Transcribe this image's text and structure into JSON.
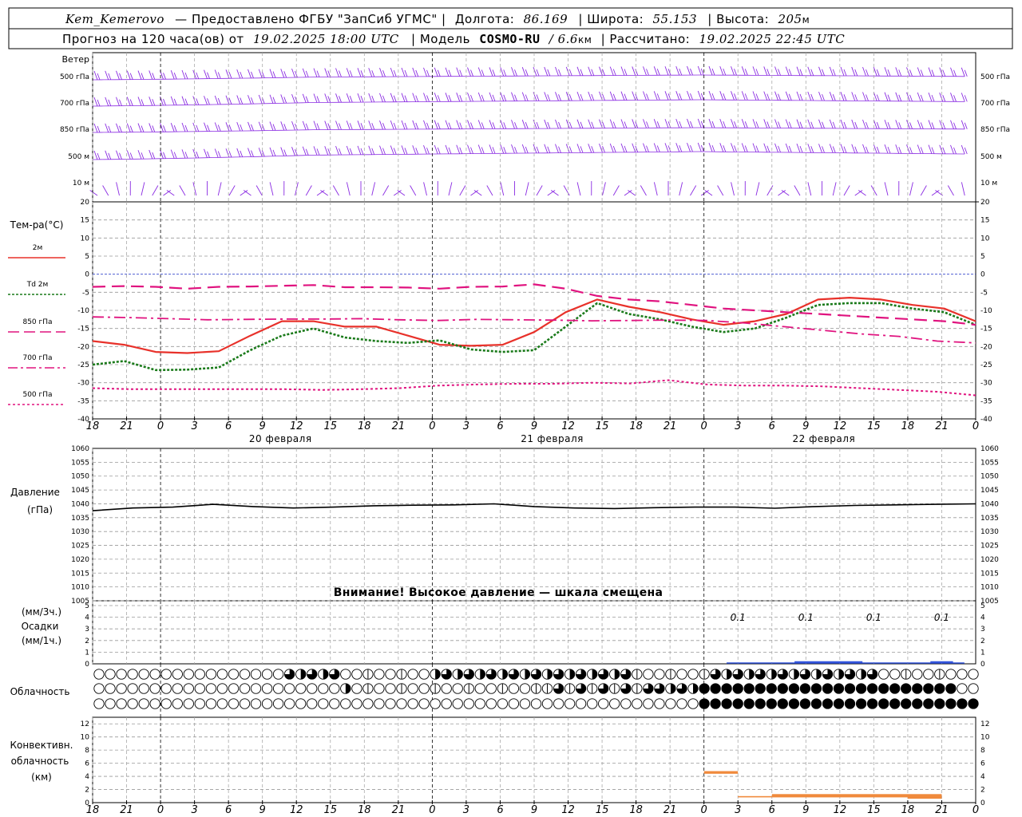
{
  "header": {
    "station": "Kem_Kemerovo",
    "provided": "— Предоставлено ФГБУ \"ЗапСиб УГМС\" |",
    "lon_label": "Долгота:",
    "lon": "86.169",
    "lat_label": "| Широта:",
    "lat": "55.153",
    "alt_label": "| Высота:",
    "alt": "205",
    "alt_unit": "м",
    "fc_label": "Прогноз на 120 часа(ов) от",
    "fc_time": "19.02.2025 18:00 UTC",
    "model_label": "| Модель",
    "model": "COSMO-RU",
    "res": "/ 6.6",
    "res_unit": "км",
    "calc_label": "| Рассчитано:",
    "calc_time": "19.02.2025 22:45 UTC"
  },
  "wind": {
    "title": "Ветер",
    "levels": [
      "500 гПа",
      "700 гПа",
      "850 гПа",
      "500 м",
      "10 м"
    ],
    "color": "#8a2be2"
  },
  "temp": {
    "title": "Тем-ра(°C)",
    "legend": [
      {
        "label": "2м",
        "color": "#e8312a",
        "dash": ""
      },
      {
        "label": "Td  2м",
        "color": "#1a7a1a",
        "dash": "3 2"
      },
      {
        "label": "850 гПа",
        "color": "#e0137f",
        "dash": "14 6"
      },
      {
        "label": "700 гПа",
        "color": "#e0137f",
        "dash": "12 4 3 4"
      },
      {
        "label": "500 гПа",
        "color": "#e0137f",
        "dash": "3 3"
      }
    ],
    "yticks": [
      20,
      15,
      10,
      5,
      0,
      -5,
      -10,
      -15,
      -20,
      -25,
      -30,
      -35,
      -40
    ]
  },
  "pressure": {
    "title": "Давление",
    "unit": "(гПа)",
    "yticks": [
      1060,
      1055,
      1050,
      1045,
      1040,
      1035,
      1030,
      1025,
      1020,
      1015,
      1010,
      1005
    ],
    "warning": "Внимание! Высокое давление — шкала смещена"
  },
  "precip": {
    "unit1": "(мм/3ч.)",
    "title": "Осадки",
    "unit2": "(мм/1ч.)",
    "yticks": [
      5,
      4,
      3,
      2,
      1,
      0
    ],
    "labels": [
      "0.1",
      "0.1",
      "0.1",
      "0.1"
    ]
  },
  "cloud": {
    "title": "Облачность"
  },
  "conv": {
    "title1": "Конвективн.",
    "title2": "облачность",
    "unit": "(км)",
    "yticks": [
      12,
      10,
      8,
      6,
      4,
      2,
      0
    ]
  },
  "xaxis": {
    "hour_labels": [
      "18",
      "21",
      "0",
      "3",
      "6",
      "9",
      "12",
      "15",
      "18",
      "21",
      "0",
      "3",
      "6",
      "9",
      "12",
      "15",
      "18",
      "21",
      "0",
      "3",
      "6",
      "9",
      "12",
      "15",
      "18",
      "21",
      "0"
    ],
    "dates": [
      "20 февраля",
      "21 февраля",
      "22 февраля"
    ]
  },
  "chart_data": {
    "type": "line",
    "x_hours_from_start": [
      0,
      3,
      6,
      9,
      12,
      15,
      18,
      21,
      24,
      27,
      30,
      33,
      36,
      39,
      42,
      45,
      48,
      51,
      54,
      57,
      60,
      63,
      66,
      69,
      72,
      75,
      78
    ],
    "x_labels": [
      "18",
      "21",
      "0",
      "3",
      "6",
      "9",
      "12",
      "15",
      "18",
      "21",
      "0",
      "3",
      "6",
      "9",
      "12",
      "15",
      "18",
      "21",
      "0",
      "3",
      "6",
      "9",
      "12",
      "15",
      "18",
      "21",
      "0"
    ],
    "temperature": {
      "ylim": [
        -40,
        20
      ],
      "series": [
        {
          "name": "2м",
          "values": [
            -18.5,
            -19.5,
            -21.5,
            -21.8,
            -21.3,
            -17,
            -13,
            -13,
            -14.5,
            -14.5,
            -17,
            -19.5,
            -19.8,
            -19.5,
            -16,
            -10.5,
            -7,
            -9,
            -10.5,
            -12.5,
            -14,
            -13,
            -11,
            -7,
            -6.5,
            -7,
            -8.5,
            -9.5,
            -13
          ]
        },
        {
          "name": "Td  2м",
          "values": [
            -25,
            -24,
            -26.5,
            -26.4,
            -25.8,
            -21,
            -17,
            -15,
            -17.5,
            -18.5,
            -19,
            -18.3,
            -20.8,
            -21.5,
            -21,
            -14.5,
            -8,
            -11,
            -12.5,
            -14.5,
            -16,
            -15,
            -12,
            -8.5,
            -8,
            -8,
            -9.5,
            -10.5,
            -14
          ]
        },
        {
          "name": "850 гПа",
          "values": [
            -3.5,
            -3.3,
            -3.5,
            -4,
            -3.5,
            -3.4,
            -3.2,
            -3,
            -3.6,
            -3.6,
            -3.7,
            -4,
            -3.5,
            -3.4,
            -2.8,
            -4,
            -6,
            -7,
            -7.5,
            -8.5,
            -9.5,
            -10,
            -10.5,
            -11,
            -11.5,
            -12,
            -12.5,
            -13,
            -14
          ]
        },
        {
          "name": "700 гПа",
          "values": [
            -11.8,
            -12,
            -12.3,
            -12.6,
            -12.5,
            -12.4,
            -12.4,
            -12.3,
            -12.6,
            -12.8,
            -12.5,
            -12.6,
            -12.7,
            -12.9,
            -12.8,
            -12.7,
            -12.8,
            -13.5,
            -14.5,
            -15.5,
            -16.5,
            -17.2,
            -18.5,
            -19
          ]
        },
        {
          "name": "500 гПа",
          "values": [
            -31.5,
            -31.8,
            -31.8,
            -31.8,
            -31.8,
            -31.8,
            -32,
            -31.8,
            -31.5,
            -30.8,
            -30.5,
            -30.3,
            -30.3,
            -30,
            -30.2,
            -29.3,
            -30.5,
            -30.8,
            -30.8,
            -31,
            -31.5,
            -32,
            -32.5,
            -33.5
          ]
        }
      ]
    },
    "pressure": {
      "ylim": [
        1005,
        1060
      ],
      "name": "Давление",
      "values": [
        1037.5,
        1038.5,
        1038.8,
        1039.8,
        1039,
        1038.5,
        1038.8,
        1039.3,
        1039.5,
        1039.6,
        1040,
        1039,
        1038.5,
        1038.3,
        1038.6,
        1038.8,
        1038.8,
        1038.4,
        1039,
        1039.4,
        1039.6,
        1039.8,
        1040
      ]
    },
    "precipitation": {
      "ylim": [
        0,
        5
      ],
      "labels": [
        "0.1",
        "0.1",
        "0.1",
        "0.1"
      ],
      "at_hours": [
        57,
        63,
        69,
        75
      ]
    },
    "cloud_cover": {
      "rows": [
        "high",
        "middle",
        "low"
      ],
      "fractions_high": "mostly clear until hour 17, partial cover hours 17-68, scattered after hour 68",
      "low_overcast_from_hour": 54
    },
    "convective_cloud": {
      "ylim": [
        0,
        13
      ],
      "bars": [
        {
          "from": 54,
          "to": 57,
          "top_km": 4.8,
          "base_km": 4.4
        },
        {
          "from": 57,
          "to": 60,
          "top_km": 1.0,
          "base_km": 0.8
        },
        {
          "from": 60,
          "to": 72,
          "top_km": 1.3,
          "base_km": 0.8
        },
        {
          "from": 72,
          "to": 75,
          "top_km": 1.3,
          "base_km": 0.6
        }
      ]
    }
  }
}
